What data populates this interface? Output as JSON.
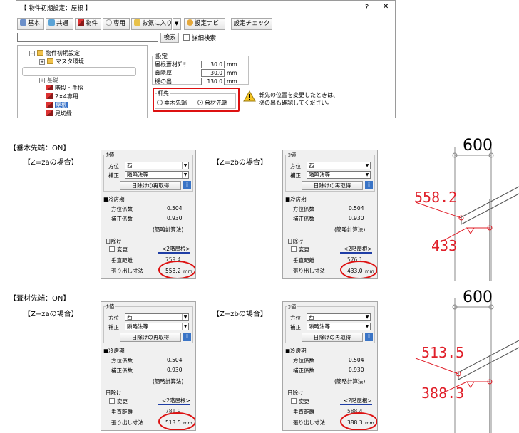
{
  "dialog": {
    "title": "【 物件初期設定：屋根 】",
    "help": "?",
    "close": "✕",
    "toolbar": {
      "basic": "基本",
      "common": "共通",
      "property": "物件",
      "dedicated": "専用",
      "favorites": "お気に入り",
      "dropdown": "▼",
      "settings_navi": "設定ナビ",
      "settings_check": "設定チェック"
    },
    "search_button": "検索",
    "detail_search": "詳細検索",
    "tree": {
      "root": "物件初期設定",
      "items": [
        "マスタ環境",
        "基礎",
        "階段・手摺",
        "2×4専用",
        "屋根",
        "見切縁"
      ]
    },
    "settings_group": "設定",
    "fields": [
      {
        "label": "屋根葺材ﾀﾞﾘ",
        "value": "30.0",
        "unit": "mm"
      },
      {
        "label": "鼻隠厚",
        "value": "30.0",
        "unit": "mm"
      },
      {
        "label": "樋の出",
        "value": "130.0",
        "unit": "mm"
      }
    ],
    "eaves_group": "軒先",
    "radio_rafter": "垂木先端",
    "radio_roofing": "葺材先端",
    "warning_line1": "軒先の位置を変更したときは、",
    "warning_line2": "樋の出も確認してください。"
  },
  "sections": [
    {
      "heading": "【垂木先端：ON】",
      "cases": [
        {
          "label": "【Z=zaの場合】",
          "ugai": "759.4",
          "result": "558.2"
        },
        {
          "label": "【Z=zbの場合】",
          "ugai": "576.1",
          "result": "433.0"
        }
      ],
      "cad": {
        "top": "600",
        "val1": "558.2",
        "val2": "433"
      }
    },
    {
      "heading": "【葺材先端：ON】",
      "cases": [
        {
          "label": "【Z=zaの場合】",
          "ugai": "781.9",
          "result": "513.5"
        },
        {
          "label": "【Z=zbの場合】",
          "ugai": "588.4",
          "result": "388.3"
        }
      ],
      "cad": {
        "top": "600",
        "val1": "513.5",
        "val2": "388.3"
      }
    }
  ],
  "panel": {
    "group": "ｶ値",
    "direction_label": "方位",
    "direction_value": "西",
    "correction_label": "補正",
    "correction_value": "隣略法等",
    "recalc_button": "日除けの再取得",
    "info": "i",
    "cooling": "■冷房期",
    "dir_coef_label": "方位係数",
    "dir_coef_value": "0.504",
    "corr_coef_label": "補正係数",
    "corr_coef_value": "0.930",
    "method": "(簡略計算法)",
    "shade_group": "日除け",
    "change": "変更",
    "roof_link": "<2階屋根>",
    "vertical_label": "垂直距離",
    "projection_label": "張り出し寸法",
    "unit": "mm"
  }
}
